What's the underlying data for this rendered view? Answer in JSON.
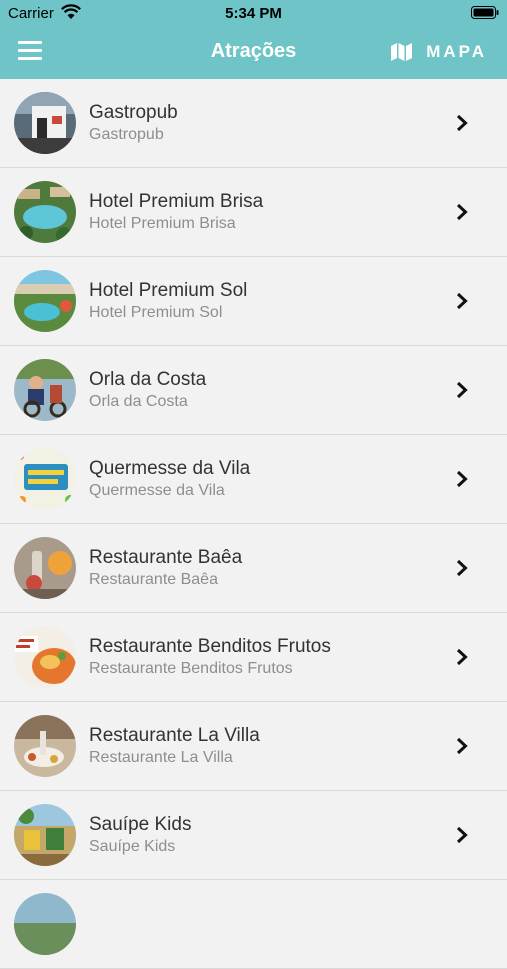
{
  "status_bar": {
    "carrier": "Carrier",
    "time": "5:34 PM"
  },
  "header": {
    "title": "Atrações",
    "map_label": "MAPA",
    "accent_color": "#6ec4c6"
  },
  "items": [
    {
      "name": "Gastropub",
      "subtitle": "Gastropub"
    },
    {
      "name": "Hotel Premium Brisa",
      "subtitle": "Hotel Premium Brisa"
    },
    {
      "name": "Hotel Premium Sol",
      "subtitle": "Hotel Premium Sol"
    },
    {
      "name": "Orla da Costa",
      "subtitle": "Orla da Costa"
    },
    {
      "name": "Quermesse da Vila",
      "subtitle": "Quermesse da Vila"
    },
    {
      "name": "Restaurante Baêa",
      "subtitle": "Restaurante Baêa"
    },
    {
      "name": "Restaurante Benditos Frutos",
      "subtitle": "Restaurante Benditos Frutos"
    },
    {
      "name": "Restaurante La Villa",
      "subtitle": "Restaurante La Villa"
    },
    {
      "name": "Sauípe Kids",
      "subtitle": "Sauípe Kids"
    }
  ]
}
